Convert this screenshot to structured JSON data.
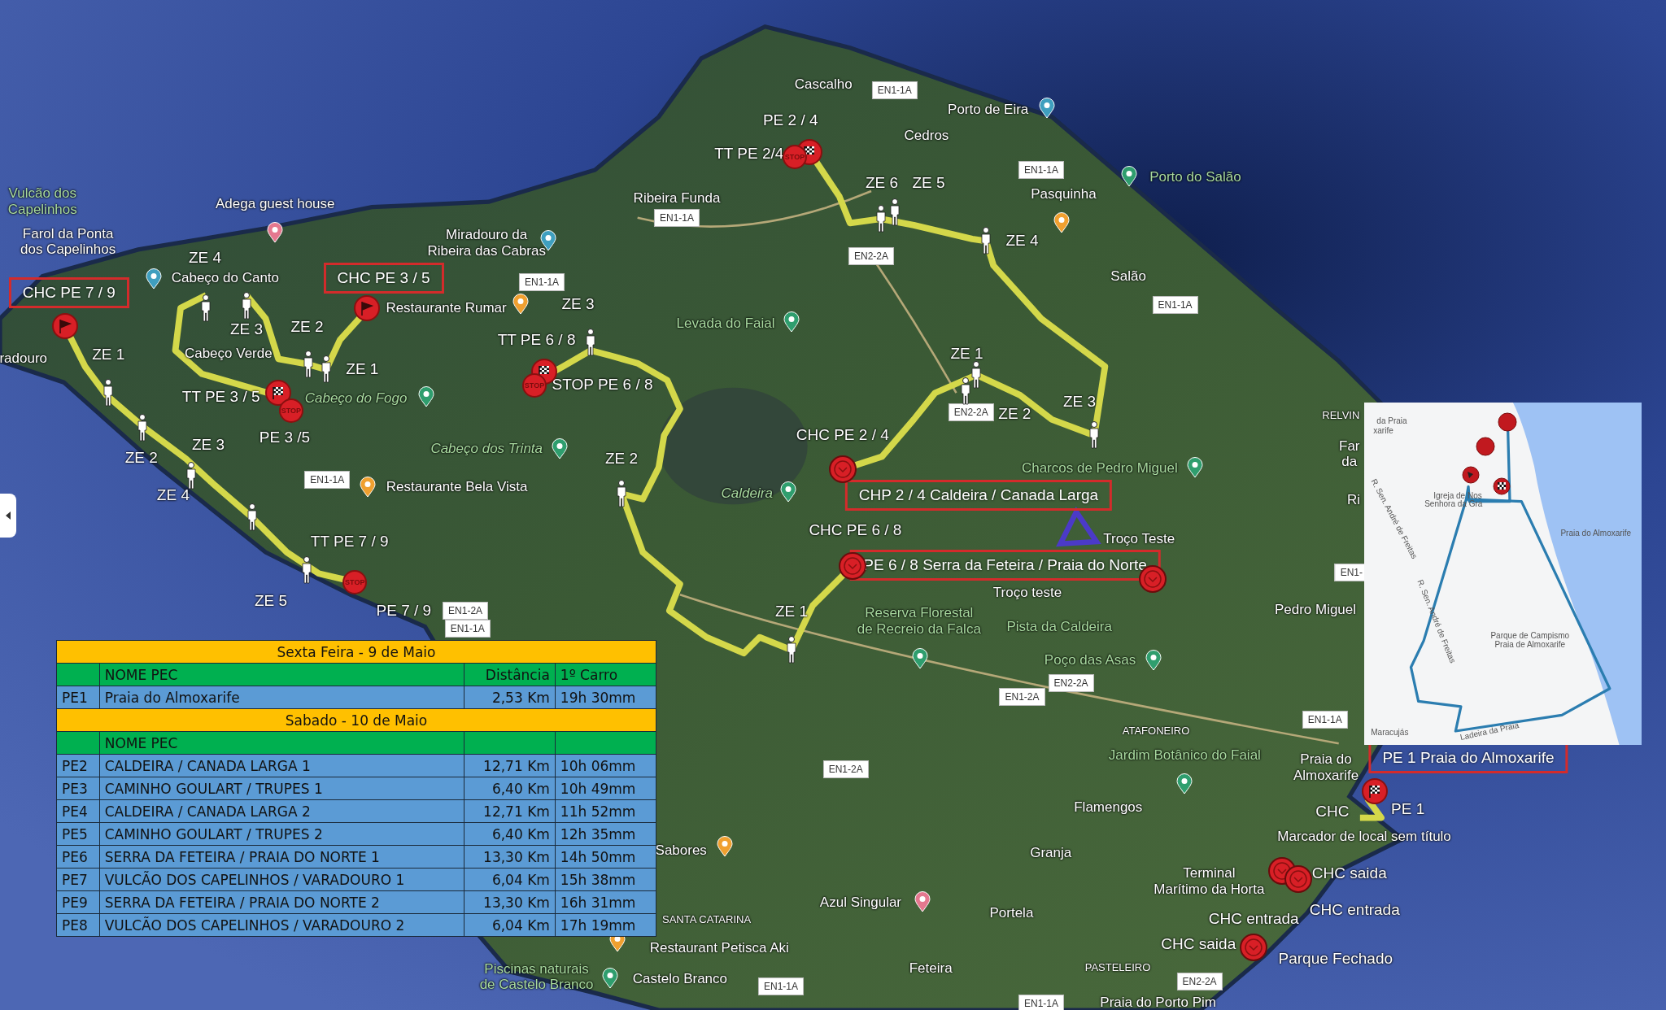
{
  "map": {
    "places": [
      {
        "text": "Vulcão dos\nCapelinhos",
        "kind": "park"
      },
      {
        "text": "Farol da Ponta\ndos Capelinhos",
        "kind": "place"
      },
      {
        "text": "Adega guest house",
        "kind": "place"
      },
      {
        "text": "Miradouro da\nRibeira das Cabras",
        "kind": "place"
      },
      {
        "text": "Cabeço do Canto",
        "kind": "place"
      },
      {
        "text": "Cabeço Verde",
        "kind": "place"
      },
      {
        "text": "Restaurante Rumar",
        "kind": "place"
      },
      {
        "text": "radouro",
        "kind": "place"
      },
      {
        "text": "Cabeço do Fogo",
        "kind": "peak"
      },
      {
        "text": "Cabeço dos Trinta",
        "kind": "peak"
      },
      {
        "text": "Restaurante Bela Vista",
        "kind": "place"
      },
      {
        "text": "Cascalho",
        "kind": "place"
      },
      {
        "text": "Porto de Eira",
        "kind": "place"
      },
      {
        "text": "Cedros",
        "kind": "place"
      },
      {
        "text": "Ribeira Funda",
        "kind": "place"
      },
      {
        "text": "Pasquinha",
        "kind": "place"
      },
      {
        "text": "Porto do Salão",
        "kind": "park"
      },
      {
        "text": "Salão",
        "kind": "place"
      },
      {
        "text": "Levada do Faial",
        "kind": "park"
      },
      {
        "text": "Caldeira",
        "kind": "peak"
      },
      {
        "text": "Charcos de Pedro Miguel",
        "kind": "park"
      },
      {
        "text": "Troço Teste",
        "kind": "place"
      },
      {
        "text": "Troço teste",
        "kind": "place"
      },
      {
        "text": "Reserva Florestal\nde Recreio da Falca",
        "kind": "park"
      },
      {
        "text": "Pista da Caldeira",
        "kind": "park"
      },
      {
        "text": "Poço das Asas",
        "kind": "park"
      },
      {
        "text": "RELVIN",
        "kind": "district"
      },
      {
        "text": "Far",
        "kind": "place"
      },
      {
        "text": "da",
        "kind": "place"
      },
      {
        "text": "Ri",
        "kind": "place"
      },
      {
        "text": "Pedro Miguel",
        "kind": "place"
      },
      {
        "text": "ATAFONEIRO",
        "kind": "district"
      },
      {
        "text": "Jardim Botânico do Faial",
        "kind": "park"
      },
      {
        "text": "Praia do\nAlmoxarife",
        "kind": "place"
      },
      {
        "text": "Flamengos",
        "kind": "place"
      },
      {
        "text": "Marcador de local sem título",
        "kind": "place"
      },
      {
        "text": "Granja",
        "kind": "place"
      },
      {
        "text": "Sabores",
        "kind": "place"
      },
      {
        "text": "Terminal\nMarítimo da Horta",
        "kind": "place"
      },
      {
        "text": "Azul Singular",
        "kind": "place"
      },
      {
        "text": "Portela",
        "kind": "place"
      },
      {
        "text": "SANTA CATARINA",
        "kind": "district"
      },
      {
        "text": "Restaurant Petisca Aki",
        "kind": "place"
      },
      {
        "text": "Piscinas naturais\nde Castelo Branco",
        "kind": "park"
      },
      {
        "text": "Castelo Branco",
        "kind": "place"
      },
      {
        "text": "Feteira",
        "kind": "place"
      },
      {
        "text": "PASTELEIRO",
        "kind": "district"
      },
      {
        "text": "Praia do Porto Pim",
        "kind": "place"
      }
    ],
    "roads": [
      "EN1-1A",
      "EN1-1A",
      "EN1-1A",
      "EN1-1A",
      "EN1-1A",
      "EN1-1A",
      "EN1-1A",
      "EN1-1A",
      "EN1-1A",
      "EN1-1A",
      "EN2-2A",
      "EN2-2A",
      "EN2-2A",
      "EN2-2A",
      "EN1-2A",
      "EN1-2A",
      "EN1-2A",
      "EN1-"
    ],
    "race_labels": [
      "PE 2 / 4",
      "TT PE 2/4",
      "ZE 6",
      "ZE 5",
      "ZE 4",
      "ZE 3",
      "TT PE 6 / 8",
      "STOP PE 6 / 8",
      "ZE 1",
      "ZE 2",
      "ZE 3",
      "CHC PE 2 / 4",
      "ZE 2",
      "CHC PE 6 / 8",
      "ZE 1",
      "ZE 4",
      "ZE 3",
      "ZE 2",
      "ZE 1",
      "TT PE 3 / 5",
      "PE 3 /5",
      "ZE 1",
      "ZE 2",
      "ZE 3",
      "ZE 4",
      "TT PE 7 / 9",
      "ZE 5",
      "PE 7 / 9",
      "CHC",
      "PE 1",
      "CHC saida",
      "CHC entrada",
      "CHC entrada",
      "CHC saida",
      "Parque Fechado"
    ],
    "boxed_labels": [
      "CHC PE 7 / 9",
      "CHC PE 3 / 5",
      "CHP 2 / 4 Caldeira / Canada Larga",
      "PE 6 / 8 Serra da Feteira / Praia do Norte",
      "PE 1 Praia do Almoxarife"
    ],
    "markers": [
      {
        "kind": "walker"
      },
      {
        "kind": "walker"
      },
      {
        "kind": "walker"
      },
      {
        "kind": "walker"
      },
      {
        "kind": "walker"
      },
      {
        "kind": "walker"
      },
      {
        "kind": "walker"
      },
      {
        "kind": "walker"
      },
      {
        "kind": "walker"
      },
      {
        "kind": "walker"
      },
      {
        "kind": "walker"
      },
      {
        "kind": "walker"
      },
      {
        "kind": "walker"
      },
      {
        "kind": "walker"
      },
      {
        "kind": "walker"
      },
      {
        "kind": "walker"
      },
      {
        "kind": "walker"
      },
      {
        "kind": "walker"
      },
      {
        "kind": "flag"
      },
      {
        "kind": "flag"
      },
      {
        "kind": "checkered"
      },
      {
        "kind": "stop",
        "text": "STOP"
      },
      {
        "kind": "checkered"
      },
      {
        "kind": "stop",
        "text": "STOP"
      },
      {
        "kind": "checkered"
      },
      {
        "kind": "stop",
        "text": "STOP"
      },
      {
        "kind": "stop",
        "text": "STOP"
      },
      {
        "kind": "checkered"
      },
      {
        "kind": "clock"
      },
      {
        "kind": "clock"
      },
      {
        "kind": "clock"
      },
      {
        "kind": "clock"
      },
      {
        "kind": "clock"
      },
      {
        "kind": "clock"
      }
    ]
  },
  "inset_map": {
    "labels": [
      "da Praia",
      "xarife",
      "Igreja de Nos",
      "Senhora da Gra",
      "Praia do Almoxarife",
      "Parque de Campismo",
      "Praia de Almoxarife",
      "R. Sen. André de Freitas",
      "R. Sen. André de Freitas",
      "Ladeira da Praia",
      "Maracujás"
    ],
    "markers": [
      {
        "kind": "dot"
      },
      {
        "kind": "dot"
      },
      {
        "kind": "flag"
      },
      {
        "kind": "checkered"
      }
    ]
  },
  "schedule": {
    "sections": [
      {
        "title": "Sexta Feira - 9 de Maio",
        "header": {
          "name": "NOME PEC",
          "distance": "Distância",
          "time": "1º Carro"
        },
        "rows": [
          {
            "code": "PE1",
            "name": "Praia do Almoxarife",
            "distance": "2,53 Km",
            "time": "19h 30mm"
          }
        ]
      },
      {
        "title": "Sabado - 10 de Maio",
        "header": {
          "name": "NOME PEC"
        },
        "rows": [
          {
            "code": "PE2",
            "name": "CALDEIRA / CANADA LARGA 1",
            "distance": "12,71 Km",
            "time": "10h 06mm"
          },
          {
            "code": "PE3",
            "name": "CAMINHO GOULART / TRUPES 1",
            "distance": "6,40 Km",
            "time": "10h 49mm"
          },
          {
            "code": "PE4",
            "name": "CALDEIRA / CANADA LARGA 2",
            "distance": "12,71 Km",
            "time": "11h 52mm"
          },
          {
            "code": "PE5",
            "name": "CAMINHO GOULART / TRUPES 2",
            "distance": "6,40 Km",
            "time": "12h 35mm"
          },
          {
            "code": "PE6",
            "name": "SERRA DA FETEIRA / PRAIA DO NORTE 1",
            "distance": "13,30 Km",
            "time": "14h 50mm"
          },
          {
            "code": "PE7",
            "name": "VULCÃO DOS CAPELINHOS / VARADOURO 1",
            "distance": "6,04 Km",
            "time": "15h 38mm"
          },
          {
            "code": "PE9",
            "name": "SERRA DA FETEIRA / PRAIA DO NORTE 2",
            "distance": "13,30 Km",
            "time": "16h 31mm"
          },
          {
            "code": "PE8",
            "name": "VULCÃO DOS CAPELINHOS / VARADOURO 2",
            "distance": "6,04 Km",
            "time": "17h 19mm"
          }
        ]
      }
    ]
  }
}
